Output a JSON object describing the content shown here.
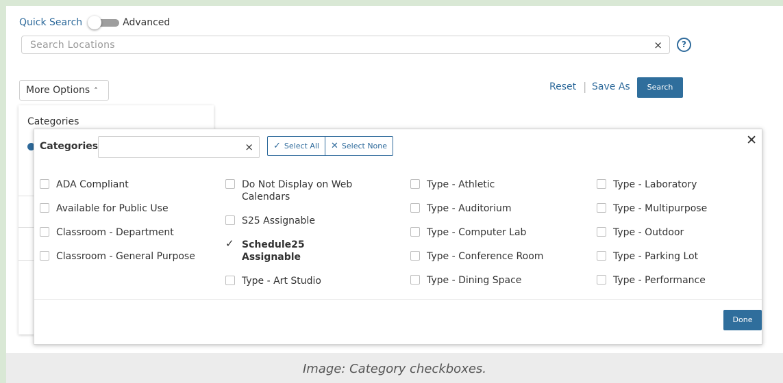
{
  "search": {
    "quick_label": "Quick Search",
    "advanced_label": "Advanced",
    "placeholder": "Search Locations",
    "clear_glyph": "×",
    "help_glyph": "?",
    "more_options_label": "More Options",
    "reset_label": "Reset",
    "save_as_label": "Save As",
    "search_button_label": "Search"
  },
  "options_card": {
    "title": "Categories"
  },
  "modal": {
    "title": "Categories",
    "filter_placeholder": "",
    "clear_glyph": "×",
    "select_all_label": "Select All",
    "select_none_label": "Select None",
    "close_glyph": "✕",
    "done_label": "Done",
    "columns": [
      [
        {
          "label": "ADA Compliant",
          "checked": false
        },
        {
          "label": "Available for Public Use",
          "checked": false
        },
        {
          "label": "Classroom - Department",
          "checked": false
        },
        {
          "label": "Classroom - General Purpose",
          "checked": false
        }
      ],
      [
        {
          "label": "Do Not Display on Web Calendars",
          "checked": false
        },
        {
          "label": "S25 Assignable",
          "checked": false
        },
        {
          "label": "Schedule25 Assignable",
          "checked": true
        },
        {
          "label": "Type - Art Studio",
          "checked": false
        }
      ],
      [
        {
          "label": "Type - Athletic",
          "checked": false
        },
        {
          "label": "Type - Auditorium",
          "checked": false
        },
        {
          "label": "Type - Computer Lab",
          "checked": false
        },
        {
          "label": "Type - Conference Room",
          "checked": false
        },
        {
          "label": "Type - Dining Space",
          "checked": false
        }
      ],
      [
        {
          "label": "Type - Laboratory",
          "checked": false
        },
        {
          "label": "Type - Multipurpose",
          "checked": false
        },
        {
          "label": "Type - Outdoor",
          "checked": false
        },
        {
          "label": "Type - Parking Lot",
          "checked": false
        },
        {
          "label": "Type - Performance",
          "checked": false
        }
      ]
    ]
  },
  "caption": "Image: Category checkboxes.",
  "colors": {
    "accent": "#2e6a9b",
    "button": "#2f6e9c",
    "outer_border": "#d9e8d5",
    "caption_bg": "#ececec"
  }
}
